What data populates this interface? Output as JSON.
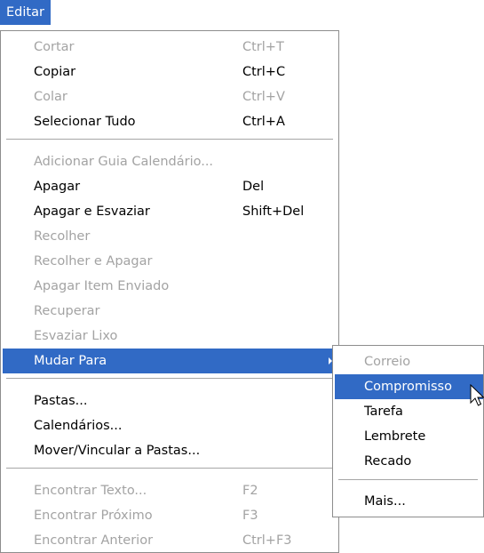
{
  "menubar": {
    "title": "Editar"
  },
  "main_menu": {
    "items": [
      {
        "label": "Cortar",
        "shortcut": "Ctrl+T",
        "enabled": false
      },
      {
        "label": "Copiar",
        "shortcut": "Ctrl+C",
        "enabled": true
      },
      {
        "label": "Colar",
        "shortcut": "Ctrl+V",
        "enabled": false
      },
      {
        "label": "Selecionar Tudo",
        "shortcut": "Ctrl+A",
        "enabled": true
      },
      {
        "label": "Adicionar Guia Calendário...",
        "shortcut": "",
        "enabled": false
      },
      {
        "label": "Apagar",
        "shortcut": "Del",
        "enabled": true
      },
      {
        "label": "Apagar e Esvaziar",
        "shortcut": "Shift+Del",
        "enabled": true
      },
      {
        "label": "Recolher",
        "shortcut": "",
        "enabled": false
      },
      {
        "label": "Recolher e Apagar",
        "shortcut": "",
        "enabled": false
      },
      {
        "label": "Apagar Item Enviado",
        "shortcut": "",
        "enabled": false
      },
      {
        "label": "Recuperar",
        "shortcut": "",
        "enabled": false
      },
      {
        "label": "Esvaziar Lixo",
        "shortcut": "",
        "enabled": false
      },
      {
        "label": "Mudar Para",
        "shortcut": "",
        "enabled": true,
        "highlighted": true,
        "has_submenu": true
      },
      {
        "label": "Pastas...",
        "shortcut": "",
        "enabled": true
      },
      {
        "label": "Calendários...",
        "shortcut": "",
        "enabled": true
      },
      {
        "label": "Mover/Vincular a Pastas...",
        "shortcut": "",
        "enabled": true
      },
      {
        "label": "Encontrar Texto...",
        "shortcut": "F2",
        "enabled": false
      },
      {
        "label": "Encontrar Próximo",
        "shortcut": "F3",
        "enabled": false
      },
      {
        "label": "Encontrar Anterior",
        "shortcut": "Ctrl+F3",
        "enabled": false
      }
    ]
  },
  "submenu": {
    "items": [
      {
        "label": "Correio",
        "enabled": false
      },
      {
        "label": "Compromisso",
        "enabled": true,
        "highlighted": true
      },
      {
        "label": "Tarefa",
        "enabled": true
      },
      {
        "label": "Lembrete",
        "enabled": true
      },
      {
        "label": "Recado",
        "enabled": true
      },
      {
        "label": "Mais...",
        "enabled": true
      }
    ]
  },
  "colors": {
    "highlight": "#316ac5",
    "disabled_text": "#a3a3a3",
    "menu_border": "#8d8d8d"
  },
  "icons": {
    "submenu_arrow": "chevron-right-icon",
    "cursor": "mouse-pointer-icon"
  }
}
